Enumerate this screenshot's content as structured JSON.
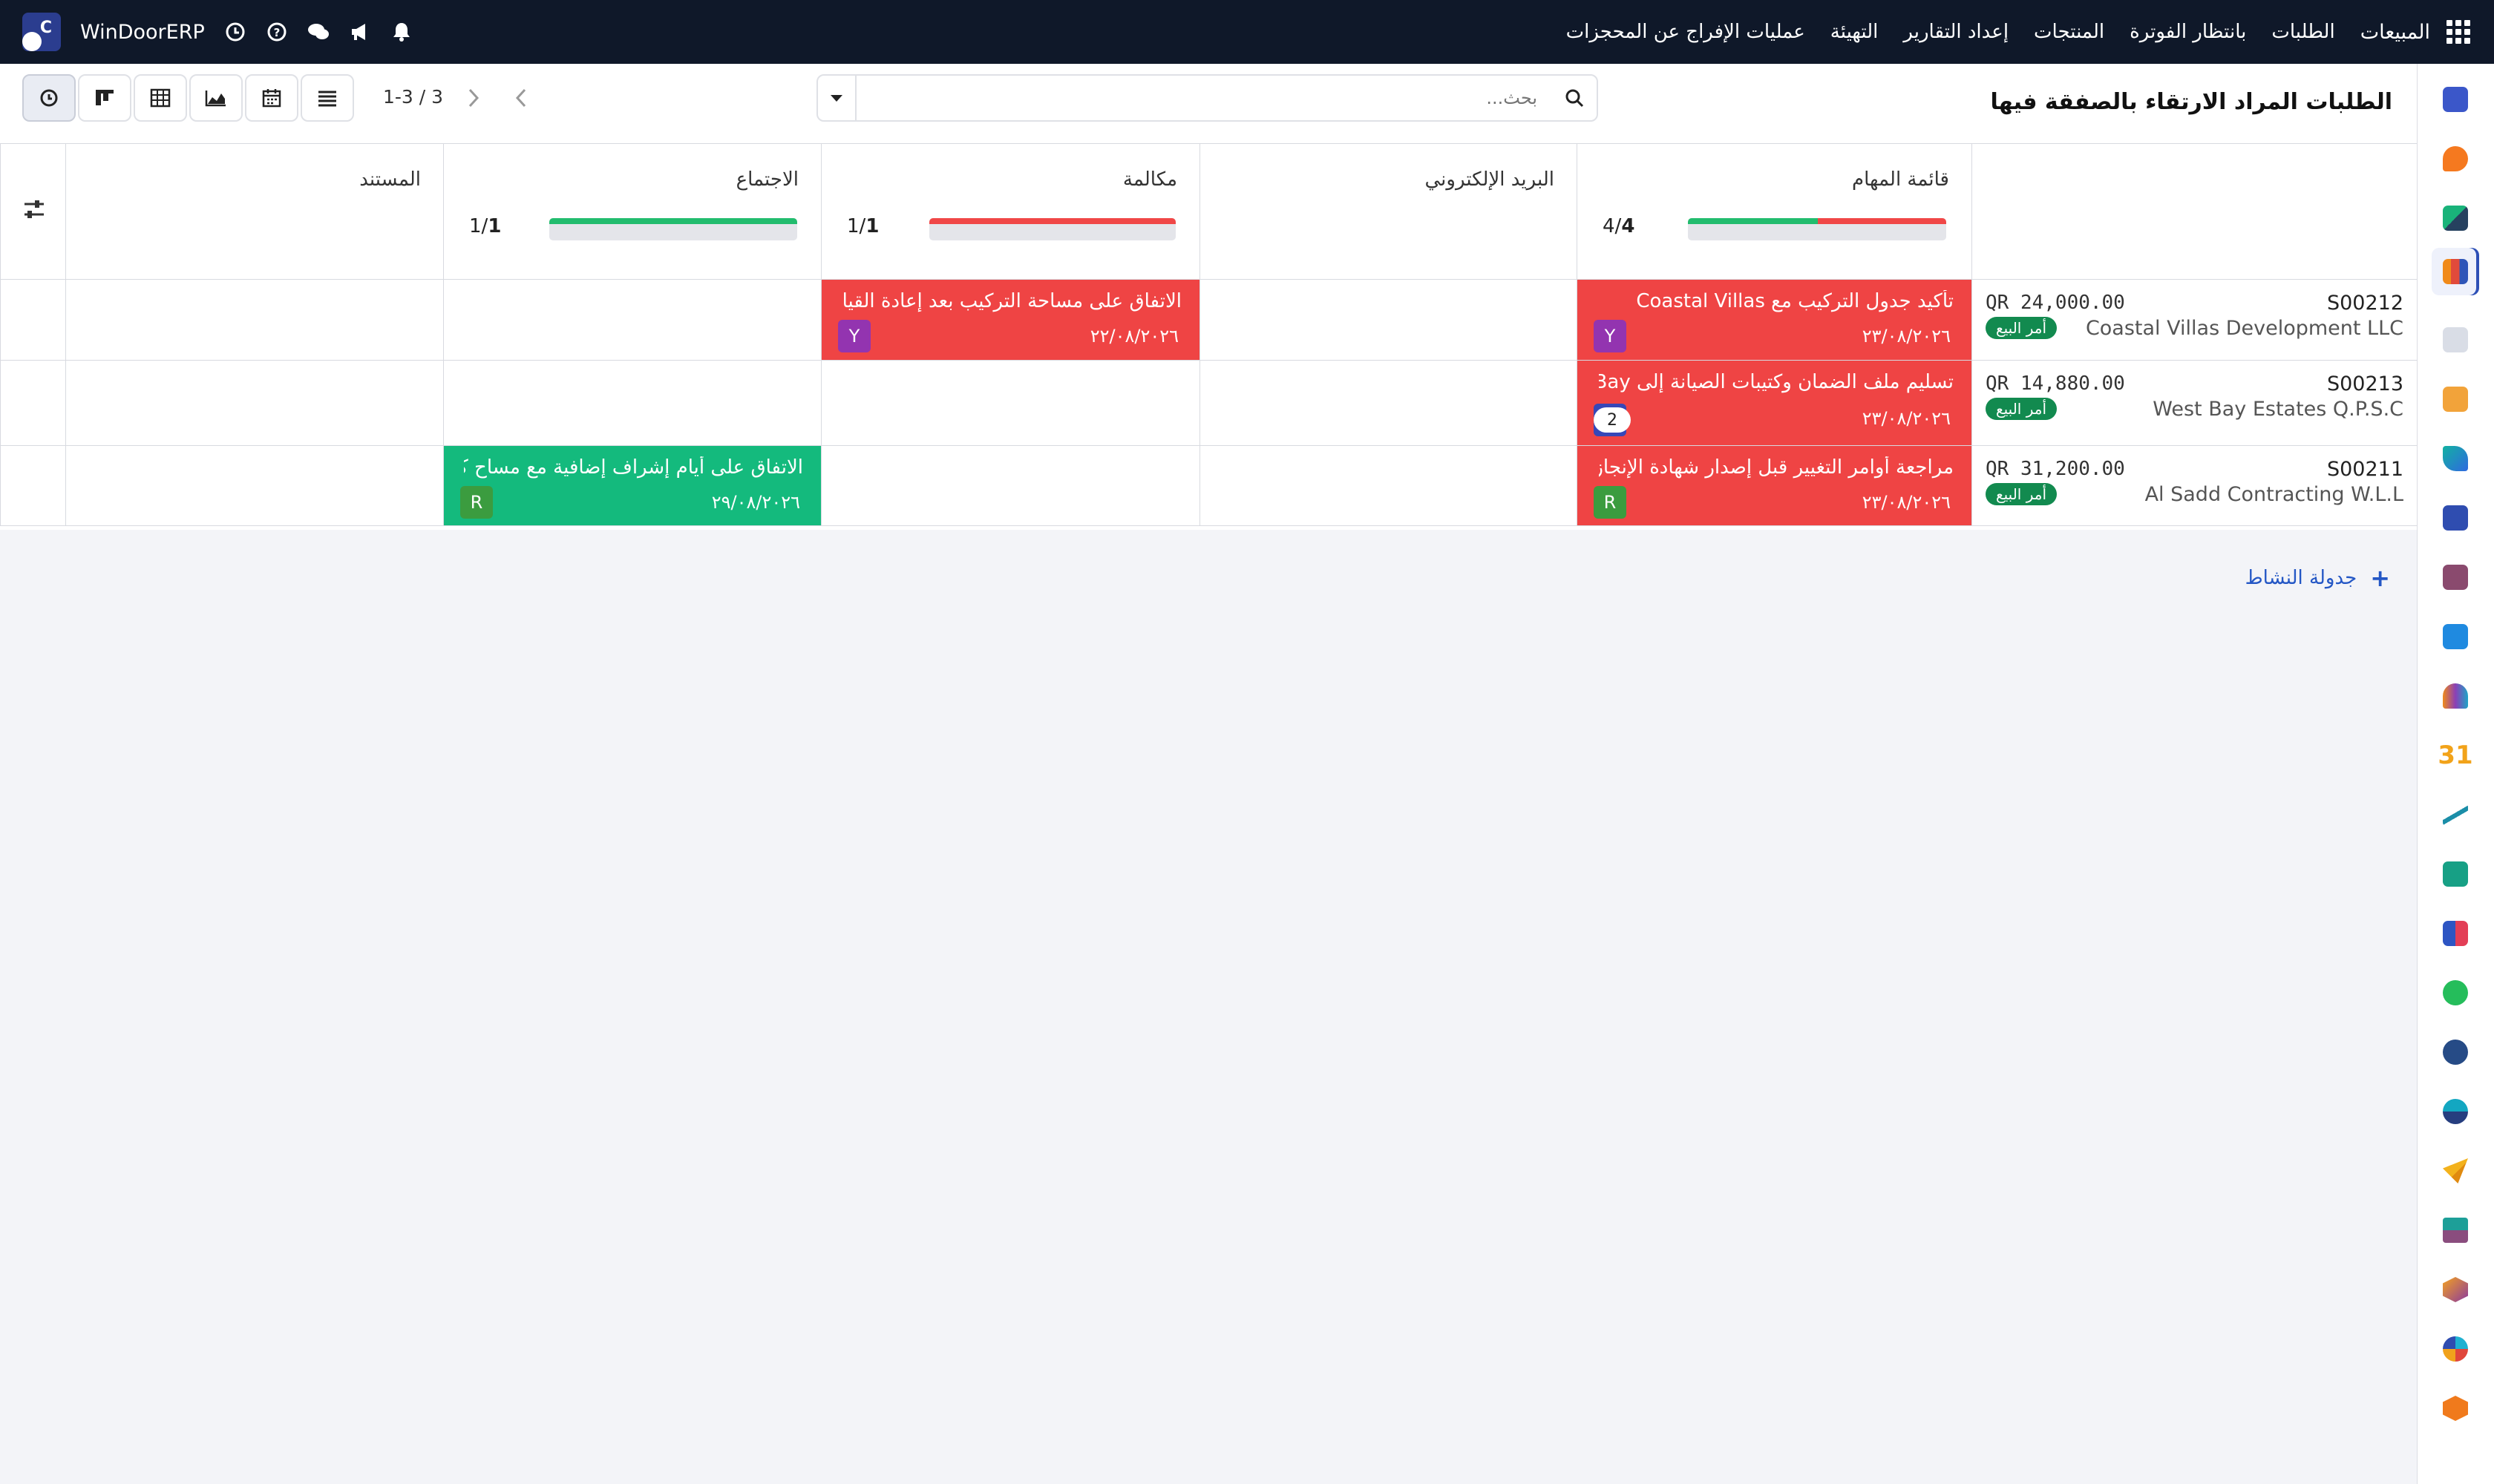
{
  "topbar": {
    "menu": [
      "المبيعات",
      "الطلبات",
      "بانتظار الفوترة",
      "المنتجات",
      "إعداد التقارير",
      "التهيئة",
      "عمليات الإفراج عن المحجزات"
    ],
    "app_name": "WinDoorERP",
    "company_logo_letter": "C"
  },
  "panel": {
    "title": "الطلبات المراد الارتقاء بالصفقة فيها",
    "search_placeholder": "بحث...",
    "pager": "1-3 / 3"
  },
  "columns": [
    {
      "title": "قائمة المهام",
      "count": "4",
      "total": "4/"
    },
    {
      "title": "البريد الإلكتروني",
      "count": "",
      "total": ""
    },
    {
      "title": "مكالمة",
      "count": "1",
      "total": "1/"
    },
    {
      "title": "الاجتماع",
      "count": "1",
      "total": "1/"
    },
    {
      "title": "المستند",
      "count": "",
      "total": ""
    }
  ],
  "records": [
    {
      "ref": "S00212",
      "customer": "Coastal Villas Development LLC",
      "amount": "QR 24,000.00",
      "badge": "أمر البيع"
    },
    {
      "ref": "S00213",
      "customer": "West Bay Estates Q.P.S.C",
      "amount": "QR 14,880.00",
      "badge": "أمر البيع"
    },
    {
      "ref": "S00211",
      "customer": "Al Sadd Contracting W.L.L",
      "amount": "QR 31,200.00",
      "badge": "أمر البيع"
    }
  ],
  "activities": {
    "r1_todo": {
      "text": "تأكيد جدول التركيب مع Coastal Villas",
      "date": "٢٣/٠٨/٢٠٢٦",
      "avatar": "Y"
    },
    "r1_call": {
      "text": "الاتفاق على مساحة التركيب بعد إعادة القياس ...",
      "date": "٢٢/٠٨/٢٠٢٦",
      "avatar": "Y"
    },
    "r2_todo": {
      "text": "تسليم ملف الضمان وكتيبات الصيانة إلى West Bay...",
      "date": "٢٣/٠٨/٢٠٢٦",
      "avatar": "M",
      "extra": "2"
    },
    "r3_todo": {
      "text": "مراجعة أوامر التغيير قبل إصدار شهادة الإنجاز",
      "date": "٢٣/٠٨/٢٠٢٦",
      "avatar": "R"
    },
    "r3_meeting": {
      "text": "الاتفاق على أيام إشراف إضافية مع مساح كميا...",
      "date": "٢٩/٠٨/٢٠٢٦",
      "avatar": "R"
    }
  },
  "add_activity_label": "جدولة النشاط",
  "colors": {
    "topbar": "#0f1829",
    "overdue": "#ef4444",
    "planned": "#14ba7d",
    "badge": "#128a4f",
    "link": "#2457c5"
  }
}
